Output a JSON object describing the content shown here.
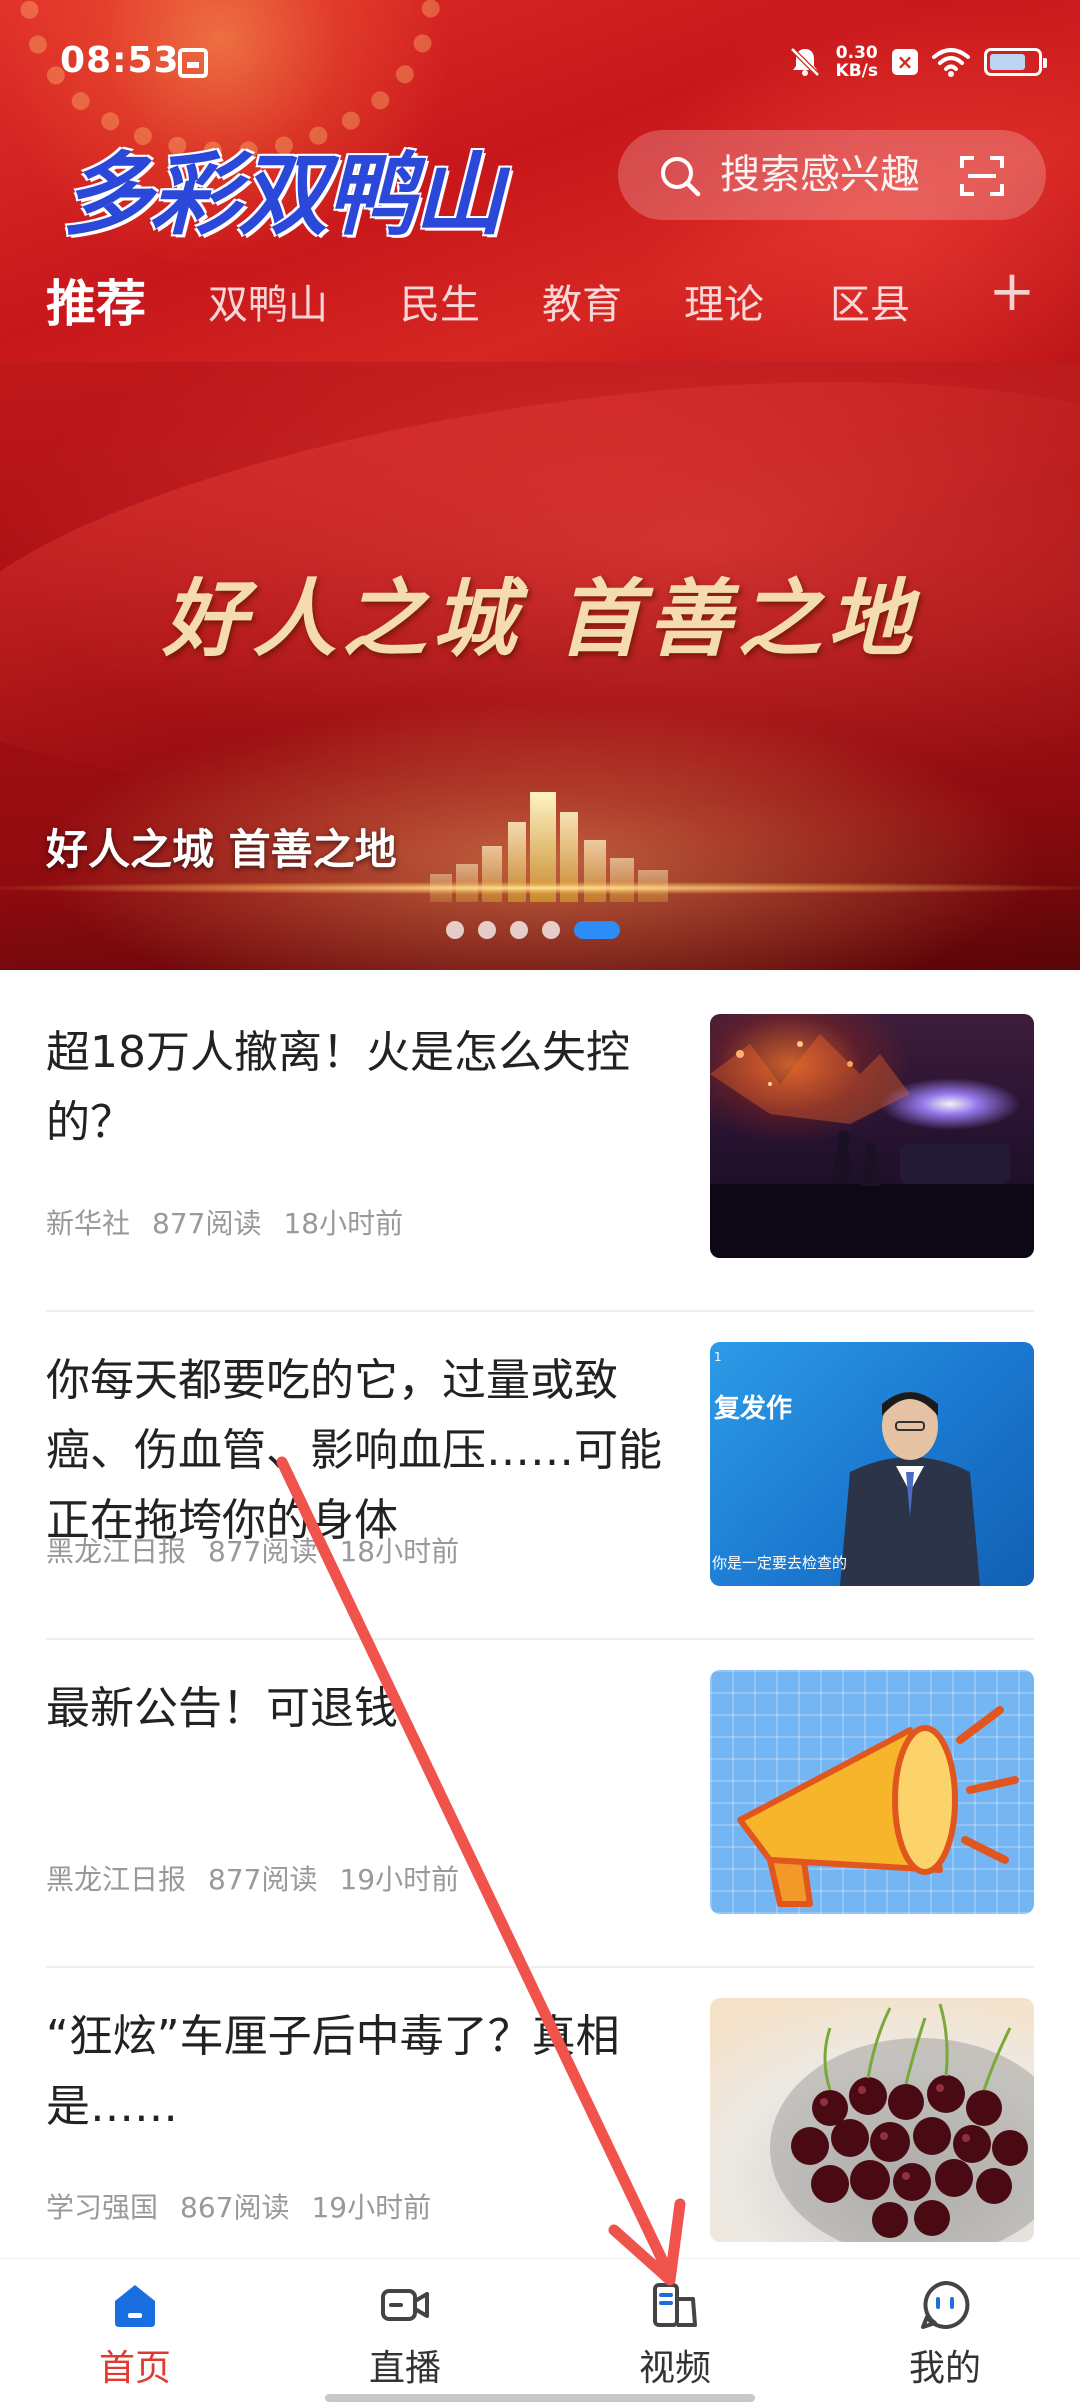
{
  "status_bar": {
    "time": "08:53",
    "net_speed_value": "0.30",
    "net_speed_unit": "KB/s",
    "battery_level": 0.75
  },
  "header": {
    "logo_text": "多彩双鸭山",
    "search_placeholder": "搜索感兴趣",
    "tabs": [
      {
        "label": "推荐",
        "active": true
      },
      {
        "label": "双鸭山",
        "active": false
      },
      {
        "label": "民生",
        "active": false
      },
      {
        "label": "教育",
        "active": false
      },
      {
        "label": "理论",
        "active": false
      },
      {
        "label": "区县",
        "active": false
      }
    ],
    "add_tab_label": "+"
  },
  "banner": {
    "headline": "好人之城  首善之地",
    "caption": "好人之城 首善之地",
    "slide_count": 5,
    "active_slide": 5
  },
  "news": [
    {
      "title": "超18万人撤离！火是怎么失控的？",
      "source": "新华社",
      "reads": "877阅读",
      "time": "18小时前",
      "thumb": "wildfire-police-scene"
    },
    {
      "title": "你每天都要吃的它，过量或致癌、伤血管、影响血压……可能正在拖垮你的身体",
      "source": "黑龙江日报",
      "reads": "877阅读",
      "time": "18小时前",
      "thumb": "tv-anchor-studio",
      "thumb_text": "复发作",
      "thumb_sub": "你是一定要去检查的",
      "thumb_num": "1"
    },
    {
      "title": "最新公告！可退钱",
      "source": "黑龙江日报",
      "reads": "877阅读",
      "time": "19小时前",
      "thumb": "megaphone-illustration"
    },
    {
      "title": "“狂炫”车厘子后中毒了？真相是……",
      "source": "学习强国",
      "reads": "867阅读",
      "time": "19小时前",
      "thumb": "cherries-bowl"
    }
  ],
  "bottom_nav": [
    {
      "label": "首页",
      "icon": "home-icon",
      "active": true
    },
    {
      "label": "直播",
      "icon": "live-camera-icon",
      "active": false
    },
    {
      "label": "视频",
      "icon": "video-icon",
      "active": false
    },
    {
      "label": "我的",
      "icon": "profile-icon",
      "active": false
    }
  ],
  "colors": {
    "brand_red": "#d42a23",
    "active_nav": "#e03b31",
    "home_icon_blue": "#1a6fe0",
    "dot_active": "#2d8cf5",
    "arrow": "#f0524c"
  }
}
